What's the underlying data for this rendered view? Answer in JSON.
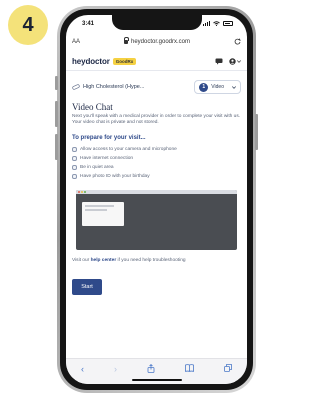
{
  "step": {
    "number": "4"
  },
  "status": {
    "time": "3:41",
    "colors": {
      "badge": "#f4e27a",
      "frame": "#151515"
    }
  },
  "browser": {
    "text_size_label": "AA",
    "url": "heydoctor.goodrx.com",
    "reload_icon": "reload-icon",
    "nav": {
      "back": "‹",
      "forward": "›",
      "share_icon": "share-icon",
      "bookmarks_icon": "book-icon",
      "tabs_icon": "tabs-icon"
    }
  },
  "app": {
    "logo": "heydoctor",
    "badge": "GoodRx",
    "icons": [
      "chat-icon",
      "account-icon"
    ]
  },
  "visit": {
    "condition": "High Cholesterol (Hype...",
    "selector_number": "1",
    "selector_label": "Video"
  },
  "page": {
    "title": "Video Chat",
    "intro": "Next you'll speak with a medical provider in order to complete your visit with us. Your video chat is private and not stored.",
    "prepare_title": "To prepare for your visit...",
    "checklist": [
      "Allow access to your camera and microphone",
      "Have internet connection",
      "Be in quiet area",
      "Have photo ID with your birthday"
    ],
    "help_prefix": "Visit our",
    "help_link": "help center",
    "help_suffix": "if you need help troubleshooting",
    "start_label": "Start",
    "accent": "#2f4a8a"
  }
}
